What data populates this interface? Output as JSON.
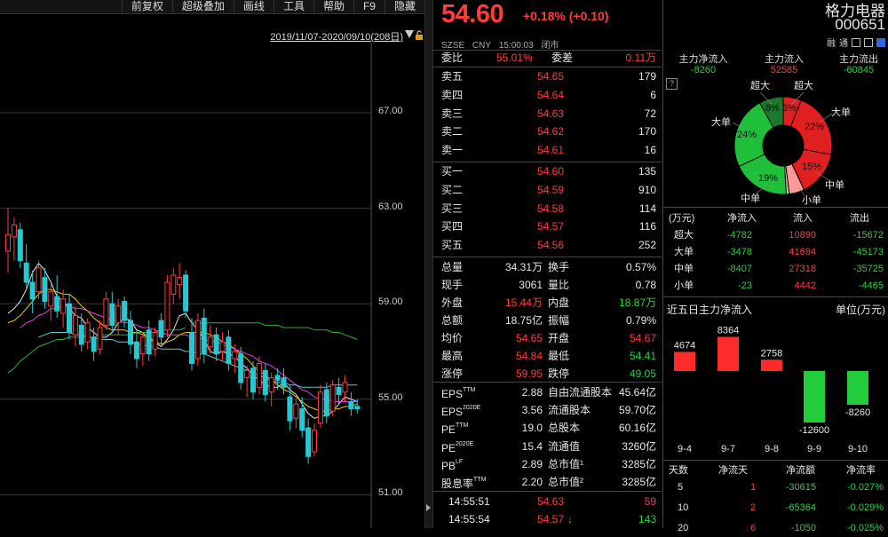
{
  "toolbar": [
    "前复权",
    "超级叠加",
    "画线",
    "工具",
    "帮助",
    "F9",
    "隐藏"
  ],
  "range_label": "2019/11/07-2020/09/10(208日)",
  "y_axis_labels": [
    "67.00",
    "63.00",
    "59.00",
    "55.00",
    "51.00"
  ],
  "colors": {
    "up": "#ff3c3c",
    "down": "#26c8d2",
    "ma5": "#e6e6e6",
    "ma10": "#f0c800",
    "ma20": "#e040e0",
    "ma30": "#60c8c8",
    "ma60": "#30b030"
  },
  "chart_data": {
    "type": "candlestick",
    "y_axis_ticks": [
      67,
      63,
      59,
      55,
      51
    ],
    "candles": [
      {
        "o": 61.2,
        "h": 63.0,
        "l": 60.3,
        "c": 61.9
      },
      {
        "o": 61.8,
        "h": 62.6,
        "l": 60.8,
        "c": 62.3
      },
      {
        "o": 62.1,
        "h": 62.4,
        "l": 60.5,
        "c": 60.8
      },
      {
        "o": 60.7,
        "h": 61.5,
        "l": 59.6,
        "c": 59.9
      },
      {
        "o": 59.9,
        "h": 60.4,
        "l": 58.6,
        "c": 59.2
      },
      {
        "o": 59.5,
        "h": 60.8,
        "l": 59.2,
        "c": 60.5
      },
      {
        "o": 60.1,
        "h": 60.5,
        "l": 58.8,
        "c": 59.1
      },
      {
        "o": 58.9,
        "h": 59.8,
        "l": 58.3,
        "c": 59.5
      },
      {
        "o": 59.3,
        "h": 60.2,
        "l": 58.4,
        "c": 58.7
      },
      {
        "o": 58.6,
        "h": 59.6,
        "l": 58.0,
        "c": 59.2
      },
      {
        "o": 59.0,
        "h": 59.4,
        "l": 57.5,
        "c": 57.8
      },
      {
        "o": 57.7,
        "h": 58.9,
        "l": 57.2,
        "c": 58.5
      },
      {
        "o": 58.1,
        "h": 58.6,
        "l": 57.0,
        "c": 57.3
      },
      {
        "o": 57.4,
        "h": 58.4,
        "l": 57.1,
        "c": 58.2
      },
      {
        "o": 57.6,
        "h": 58.0,
        "l": 56.6,
        "c": 57.0
      },
      {
        "o": 57.1,
        "h": 58.3,
        "l": 56.9,
        "c": 58.0
      },
      {
        "o": 58.1,
        "h": 59.5,
        "l": 57.9,
        "c": 59.2
      },
      {
        "o": 59.0,
        "h": 59.5,
        "l": 57.8,
        "c": 58.1
      },
      {
        "o": 58.2,
        "h": 59.2,
        "l": 57.7,
        "c": 58.9
      },
      {
        "o": 59.1,
        "h": 59.3,
        "l": 58.0,
        "c": 58.3
      },
      {
        "o": 58.3,
        "h": 58.7,
        "l": 56.9,
        "c": 57.3
      },
      {
        "o": 57.4,
        "h": 57.9,
        "l": 56.3,
        "c": 56.7
      },
      {
        "o": 56.9,
        "h": 57.8,
        "l": 56.4,
        "c": 57.6
      },
      {
        "o": 57.9,
        "h": 58.3,
        "l": 56.6,
        "c": 56.9
      },
      {
        "o": 57.1,
        "h": 58.0,
        "l": 56.8,
        "c": 57.8
      },
      {
        "o": 58.3,
        "h": 58.6,
        "l": 57.3,
        "c": 57.6
      },
      {
        "o": 57.9,
        "h": 60.2,
        "l": 57.6,
        "c": 59.9
      },
      {
        "o": 59.4,
        "h": 60.5,
        "l": 59.0,
        "c": 60.2
      },
      {
        "o": 59.8,
        "h": 60.7,
        "l": 59.2,
        "c": 60.1
      },
      {
        "o": 60.2,
        "h": 60.4,
        "l": 58.4,
        "c": 58.7
      },
      {
        "o": 57.8,
        "h": 58.4,
        "l": 56.2,
        "c": 56.5
      },
      {
        "o": 56.7,
        "h": 58.6,
        "l": 56.4,
        "c": 58.3
      },
      {
        "o": 58.4,
        "h": 58.8,
        "l": 56.5,
        "c": 56.9
      },
      {
        "o": 57.2,
        "h": 58.1,
        "l": 56.9,
        "c": 57.6
      },
      {
        "o": 57.7,
        "h": 58.0,
        "l": 56.6,
        "c": 56.9
      },
      {
        "o": 57.0,
        "h": 57.8,
        "l": 56.6,
        "c": 57.4
      },
      {
        "o": 57.6,
        "h": 57.9,
        "l": 56.2,
        "c": 56.5
      },
      {
        "o": 56.7,
        "h": 57.3,
        "l": 56.1,
        "c": 57.0
      },
      {
        "o": 56.9,
        "h": 57.2,
        "l": 55.4,
        "c": 55.7
      },
      {
        "o": 55.9,
        "h": 56.4,
        "l": 55.1,
        "c": 56.2
      },
      {
        "o": 56.3,
        "h": 56.6,
        "l": 55.0,
        "c": 55.3
      },
      {
        "o": 55.5,
        "h": 56.8,
        "l": 55.2,
        "c": 56.5
      },
      {
        "o": 56.2,
        "h": 56.5,
        "l": 54.9,
        "c": 55.2
      },
      {
        "o": 55.3,
        "h": 56.1,
        "l": 54.7,
        "c": 55.9
      },
      {
        "o": 56.0,
        "h": 56.3,
        "l": 55.4,
        "c": 55.8
      },
      {
        "o": 55.9,
        "h": 56.3,
        "l": 55.2,
        "c": 55.5
      },
      {
        "o": 55.1,
        "h": 55.6,
        "l": 53.7,
        "c": 54.1
      },
      {
        "o": 54.2,
        "h": 55.0,
        "l": 53.8,
        "c": 54.8
      },
      {
        "o": 54.6,
        "h": 55.1,
        "l": 53.4,
        "c": 53.7
      },
      {
        "o": 53.8,
        "h": 54.2,
        "l": 52.3,
        "c": 52.6
      },
      {
        "o": 52.8,
        "h": 54.0,
        "l": 52.6,
        "c": 53.7
      },
      {
        "o": 54.0,
        "h": 55.6,
        "l": 53.8,
        "c": 55.3
      },
      {
        "o": 55.4,
        "h": 55.7,
        "l": 54.0,
        "c": 54.3
      },
      {
        "o": 54.5,
        "h": 55.8,
        "l": 54.3,
        "c": 55.6
      },
      {
        "o": 55.5,
        "h": 55.9,
        "l": 54.8,
        "c": 55.2
      },
      {
        "o": 55.3,
        "h": 56.0,
        "l": 54.9,
        "c": 55.7
      },
      {
        "o": 54.9,
        "h": 55.3,
        "l": 54.3,
        "c": 54.6
      },
      {
        "o": 54.7,
        "h": 55.0,
        "l": 54.4,
        "c": 54.6
      }
    ],
    "ma_lines": [
      {
        "name": "MA5",
        "values": [
          58.6,
          58.8,
          59.1,
          59.6,
          60.3,
          60.7,
          60.4,
          59.9,
          59.3,
          59.1,
          58.8,
          58.5,
          58.4,
          58.0,
          57.8,
          57.6,
          57.6,
          57.8,
          58.2,
          58.4,
          58.3,
          57.9,
          57.8,
          57.5,
          57.4,
          57.2,
          57.5,
          57.9,
          58.5,
          58.6,
          58.2,
          57.9,
          57.5,
          57.0,
          56.9,
          57.0,
          56.9,
          56.8,
          56.5,
          56.3,
          56.0,
          55.8,
          55.6,
          55.5,
          55.5,
          55.7,
          55.4,
          55.2,
          54.8,
          54.4,
          54.2,
          54.3,
          54.3,
          54.5,
          54.8,
          55.1,
          55.0,
          54.9
        ]
      },
      {
        "name": "MA10",
        "values": [
          58.2,
          58.3,
          58.5,
          58.8,
          59.1,
          59.4,
          59.6,
          59.6,
          59.5,
          59.4,
          59.4,
          59.2,
          58.9,
          58.7,
          58.4,
          58.2,
          58.0,
          57.9,
          57.9,
          57.9,
          57.8,
          57.8,
          57.7,
          57.6,
          57.4,
          57.3,
          57.4,
          57.5,
          57.7,
          57.8,
          57.8,
          57.8,
          57.8,
          57.7,
          57.6,
          57.4,
          57.3,
          57.1,
          56.9,
          56.7,
          56.4,
          56.2,
          56.0,
          55.8,
          55.6,
          55.4,
          55.3,
          55.1,
          54.9,
          54.7,
          54.6,
          54.5,
          54.5,
          54.6,
          54.6,
          54.7,
          54.7,
          54.8
        ]
      },
      {
        "name": "MA20",
        "values": [
          null,
          null,
          58.0,
          58.2,
          58.3,
          58.5,
          58.6,
          58.8,
          58.8,
          58.9,
          58.9,
          58.8,
          58.8,
          58.7,
          58.6,
          58.5,
          58.4,
          58.3,
          58.3,
          58.2,
          58.2,
          58.1,
          58.0,
          58.0,
          57.9,
          57.8,
          57.7,
          57.7,
          57.7,
          57.7,
          57.6,
          57.6,
          57.5,
          57.4,
          57.4,
          57.3,
          57.2,
          57.1,
          57.0,
          56.9,
          56.8,
          56.6,
          56.5,
          56.4,
          56.2,
          56.0,
          55.8,
          55.6,
          55.4,
          55.3,
          55.1,
          55.0,
          55.0,
          54.9,
          54.9,
          54.9,
          54.9,
          54.9
        ]
      },
      {
        "name": "MA30",
        "values": [
          null,
          null,
          null,
          null,
          null,
          57.6,
          57.7,
          57.8,
          57.8,
          57.8,
          57.8,
          57.7,
          57.7,
          57.6,
          57.6,
          57.5,
          57.5,
          57.5,
          57.4,
          57.4,
          57.4,
          57.3,
          57.3,
          57.2,
          57.2,
          57.1,
          57.1,
          57.1,
          57.1,
          57.0,
          57.0,
          56.9,
          56.9,
          56.8,
          56.7,
          56.6,
          56.5,
          56.4,
          56.3,
          56.2,
          56.1,
          56.0,
          55.9,
          55.8,
          55.7,
          55.7,
          55.6,
          55.6,
          55.5,
          55.5,
          55.5,
          55.5,
          55.5,
          55.6,
          55.6,
          55.6,
          55.6,
          55.6
        ]
      },
      {
        "name": "MA60",
        "values": [
          null,
          null,
          null,
          null,
          null,
          null,
          null,
          null,
          null,
          null,
          null,
          null,
          null,
          null,
          null,
          null,
          null,
          null,
          null,
          null,
          null,
          null,
          null,
          null,
          null,
          null,
          null,
          null,
          null,
          null,
          58.2,
          58.2,
          58.2,
          58.2,
          58.2,
          58.2,
          58.2,
          58.2,
          58.2,
          58.2,
          58.2,
          58.2,
          58.1,
          58.1,
          58.1,
          58.0,
          58.0,
          58.0,
          58.0,
          58.0,
          57.9,
          57.9,
          57.9,
          57.8,
          57.8,
          57.7,
          57.6,
          57.5
        ]
      },
      {
        "name": "MA_LONG",
        "values": [
          56.1,
          56.3,
          56.6,
          56.8,
          57.0,
          57.2,
          57.3,
          57.4,
          57.5,
          57.5,
          57.6,
          57.6,
          57.6,
          57.6,
          57.6,
          57.7,
          57.7,
          57.7,
          57.7,
          57.7,
          57.7,
          57.8,
          57.8,
          57.8,
          57.8,
          57.9,
          57.9,
          57.9,
          57.9,
          58.0,
          null,
          null,
          null,
          null,
          null,
          null,
          null,
          null,
          null,
          null,
          null,
          null,
          null,
          null,
          null,
          null,
          null,
          null,
          null,
          null,
          null,
          null,
          null,
          null,
          null,
          null,
          null,
          null
        ]
      }
    ]
  },
  "quote": {
    "price": "54.60",
    "change": "+0.18% (+0.10)",
    "meta": [
      "SZSE",
      "CNY",
      "15:00:03",
      "闭市"
    ],
    "weibi": {
      "label": "委比",
      "value": "55.01%",
      "label2": "委差",
      "value2": "0.11万"
    },
    "asks": [
      {
        "label": "卖五",
        "price": "54.65",
        "vol": "179"
      },
      {
        "label": "卖四",
        "price": "54.64",
        "vol": "6"
      },
      {
        "label": "卖三",
        "price": "54.63",
        "vol": "72"
      },
      {
        "label": "卖二",
        "price": "54.62",
        "vol": "170"
      },
      {
        "label": "卖一",
        "price": "54.61",
        "vol": "16"
      }
    ],
    "bids": [
      {
        "label": "买一",
        "price": "54.60",
        "vol": "135"
      },
      {
        "label": "买二",
        "price": "54.59",
        "vol": "910"
      },
      {
        "label": "买三",
        "price": "54.58",
        "vol": "114"
      },
      {
        "label": "买四",
        "price": "54.57",
        "vol": "116"
      },
      {
        "label": "买五",
        "price": "54.56",
        "vol": "252"
      }
    ],
    "stats": [
      {
        "l1": "总量",
        "v1": "34.31万",
        "c1": "white",
        "l2": "换手",
        "v2": "0.57%",
        "c2": "white"
      },
      {
        "l1": "现手",
        "v1": "3061",
        "c1": "white",
        "l2": "量比",
        "v2": "0.78",
        "c2": "white"
      },
      {
        "l1": "外盘",
        "v1": "15.44万",
        "c1": "red",
        "l2": "内盘",
        "v2": "18.87万",
        "c2": "green"
      },
      {
        "l1": "总额",
        "v1": "18.75亿",
        "c1": "white",
        "l2": "振幅",
        "v2": "0.79%",
        "c2": "white"
      },
      {
        "l1": "均价",
        "v1": "54.65",
        "c1": "red",
        "l2": "开盘",
        "v2": "54.67",
        "c2": "red"
      },
      {
        "l1": "最高",
        "v1": "54.84",
        "c1": "red",
        "l2": "最低",
        "v2": "54.41",
        "c2": "green"
      },
      {
        "l1": "涨停",
        "v1": "59.95",
        "c1": "red",
        "l2": "跌停",
        "v2": "49.05",
        "c2": "green"
      }
    ],
    "fundamentals": [
      {
        "l1": "EPS",
        "sup1": "TTM",
        "v1": "2.88",
        "l2": "自由流通股本",
        "v2": "45.64亿"
      },
      {
        "l1": "EPS",
        "sup1": "2020E",
        "v1": "3.56",
        "l2": "流通股本",
        "v2": "59.70亿"
      },
      {
        "l1": "PE",
        "sup1": "TTM",
        "v1": "19.0",
        "l2": "总股本",
        "v2": "60.16亿"
      },
      {
        "l1": "PE",
        "sup1": "2020E",
        "v1": "15.4",
        "l2": "流通值",
        "v2": "3260亿"
      },
      {
        "l1": "PB",
        "sup1": "LF",
        "v1": "2.89",
        "l2": "总市值¹",
        "v2": "3285亿"
      },
      {
        "l1": "股息率",
        "sup1": "TTM",
        "v1": "2.20",
        "l2": "总市值²",
        "v2": "3285亿"
      }
    ],
    "ticks": [
      {
        "time": "14:55:51",
        "price": "54.63",
        "arrow": "",
        "vol": "59",
        "vcolor": "red"
      },
      {
        "time": "14:55:54",
        "price": "54.57",
        "arrow": "↓",
        "vol": "143",
        "vcolor": "green"
      }
    ]
  },
  "right": {
    "name": "格力电器",
    "code": "000651",
    "icons": [
      "融",
      "通"
    ],
    "flow_heads": [
      "主力净流入",
      "主力流入",
      "主力流出"
    ],
    "flow_vals": [
      "-8260",
      "52585",
      "-60845"
    ],
    "flow_colors": [
      "green",
      "red",
      "green"
    ],
    "donut": {
      "labels": {
        "super_out": "超大",
        "super_in": "超大",
        "big_in": "大单",
        "big_out": "大单",
        "mid_in": "中单",
        "mid_out": "中单",
        "small": "小单"
      },
      "slices": [
        {
          "name": "超大流入",
          "pct": 6,
          "color": "#e02020"
        },
        {
          "name": "大单流入",
          "pct": 22,
          "color": "#e02020"
        },
        {
          "name": "中单流入",
          "pct": 15,
          "color": "#e02020"
        },
        {
          "name": "小单流入",
          "pct": 5,
          "color": "#ff9a9a"
        },
        {
          "name": "小单流出",
          "pct": 1,
          "color": "#9ae09a"
        },
        {
          "name": "中单流出",
          "pct": 19,
          "color": "#1fbf3a"
        },
        {
          "name": "大单流出",
          "pct": 24,
          "color": "#1fbf3a"
        },
        {
          "name": "超大流出",
          "pct": 8,
          "color": "#1a7a2a"
        }
      ],
      "printed_pcts": [
        "8%",
        "6%",
        "22%",
        "15%",
        "19%",
        "24%"
      ]
    },
    "table_head": [
      "(万元)",
      "净流入",
      "流入",
      "流出"
    ],
    "table_rows": [
      {
        "name": "超大",
        "net": "-4782",
        "in": "10890",
        "out": "-15672"
      },
      {
        "name": "大单",
        "net": "-3478",
        "in": "41694",
        "out": "-45173"
      },
      {
        "name": "中单",
        "net": "-8407",
        "in": "27318",
        "out": "-35725"
      },
      {
        "name": "小单",
        "net": "-23",
        "in": "4442",
        "out": "-4465"
      }
    ],
    "five_day_title": "近五日主力净流入",
    "five_day_unit": "单位(万元)",
    "five_day_chart": {
      "type": "bar",
      "categories": [
        "9-4",
        "9-7",
        "9-8",
        "9-9",
        "9-10"
      ],
      "values": [
        4674,
        8364,
        2758,
        -12600,
        -8260
      ]
    },
    "period_head": [
      "天数",
      "净流天",
      "净流额",
      "净流率"
    ],
    "period_rows": [
      {
        "days": "5",
        "nd": "1",
        "amt": "-30615",
        "rate": "-0.027%"
      },
      {
        "days": "10",
        "nd": "2",
        "amt": "-65364",
        "rate": "-0.029%"
      },
      {
        "days": "20",
        "nd": "6",
        "amt": "-1050",
        "rate": "-0.025%"
      }
    ]
  }
}
